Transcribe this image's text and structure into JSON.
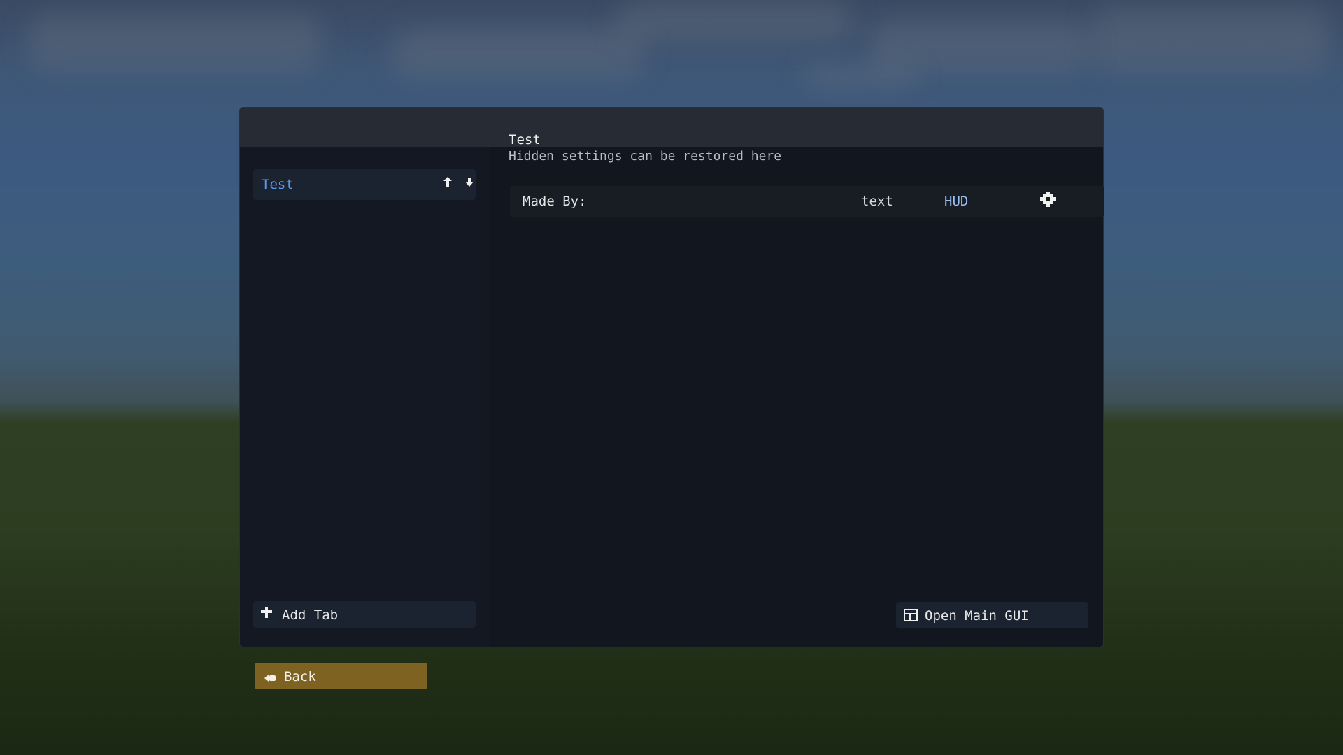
{
  "colors": {
    "panel_bg": "#12161f",
    "panel_header": "#262b34",
    "accent_blue": "#5b9cf2",
    "category_blue": "#9cc0f5",
    "back_button": "#7e6221"
  },
  "sidebar": {
    "tabs": [
      {
        "label": "Test",
        "selected": true,
        "icons": [
          "move-up-icon",
          "move-down-icon"
        ]
      }
    ],
    "add_tab": {
      "icon": "plus-icon",
      "label": "Add Tab"
    }
  },
  "main": {
    "title": "Test",
    "subtitle": "Hidden settings can be restored here",
    "rows": [
      {
        "name": "Made By:",
        "type": "text",
        "category": "HUD",
        "icon": "gear-icon"
      }
    ],
    "open_main_gui": {
      "icon": "window-icon",
      "label": "Open Main GUI"
    }
  },
  "footer": {
    "back": {
      "icon": "back-icon",
      "label": "Back"
    }
  }
}
